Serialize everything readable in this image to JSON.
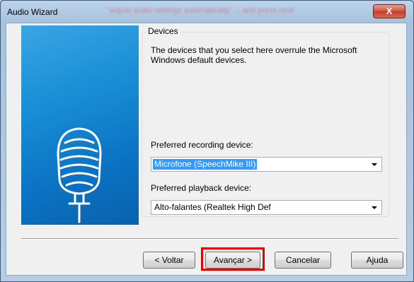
{
  "window": {
    "title": "Audio Wizard",
    "blurred_title_text": "\"Adjust audio settings automatically\" ... and press next",
    "close_label": "X"
  },
  "group": {
    "label": "Devices",
    "description": "The devices that you select here overrule the Microsoft Windows default devices."
  },
  "recording": {
    "label": "Preferred recording device:",
    "value": "Microfone (SpeechMike III)"
  },
  "playback": {
    "label": "Preferred playback device:",
    "value": "Alto-falantes (Realtek High Def"
  },
  "buttons": {
    "back": "< Voltar",
    "next": "Avançar >",
    "cancel": "Cancelar",
    "help": "Ajuda"
  },
  "colors": {
    "highlight": "#e30000",
    "banner": "#1a8fd6",
    "selection": "#3399ff"
  },
  "icons": {
    "banner": "microphone-icon"
  }
}
